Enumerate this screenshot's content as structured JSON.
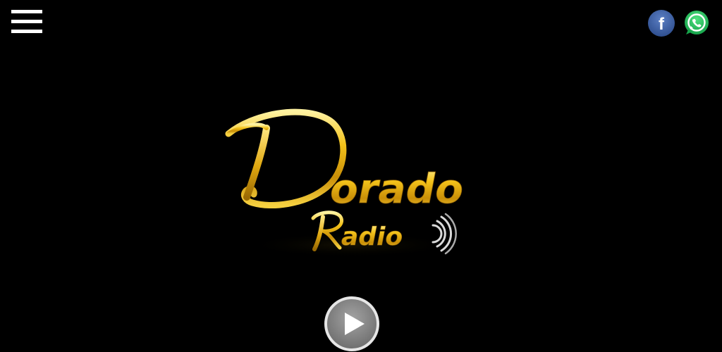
{
  "header": {
    "menu_icon": "hamburger-menu-icon",
    "social": [
      {
        "name": "facebook",
        "icon": "facebook-icon",
        "color": "#3b5998",
        "glyph": "f"
      },
      {
        "name": "whatsapp",
        "icon": "whatsapp-icon",
        "color": "#25d366"
      }
    ]
  },
  "logo": {
    "initial": "D",
    "word_rest": "orado",
    "sub_initial": "R",
    "sub_rest": "adio",
    "gold": "#f3c21a",
    "gold_dark": "#b8860b"
  },
  "player": {
    "icon": "play-icon",
    "button_color": "#8c8c8c",
    "ring_color": "#e6e6e6"
  }
}
